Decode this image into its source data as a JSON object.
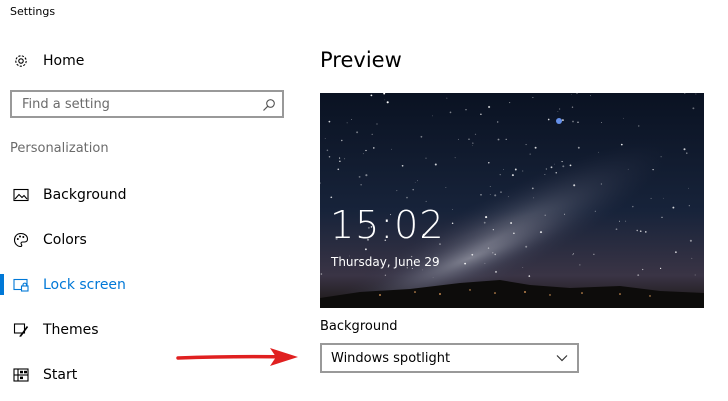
{
  "window": {
    "title": "Settings"
  },
  "sidebar": {
    "home": {
      "label": "Home",
      "icon": "gear-icon"
    },
    "search": {
      "placeholder": "Find a setting",
      "value": "",
      "icon": "search-icon"
    },
    "section_header": "Personalization",
    "items": [
      {
        "label": "Background",
        "icon": "picture-icon",
        "active": false
      },
      {
        "label": "Colors",
        "icon": "palette-icon",
        "active": false
      },
      {
        "label": "Lock screen",
        "icon": "lock-screen-icon",
        "active": true
      },
      {
        "label": "Themes",
        "icon": "brush-icon",
        "active": false
      },
      {
        "label": "Start",
        "icon": "start-tiles-icon",
        "active": false
      }
    ]
  },
  "main": {
    "preview_title": "Preview",
    "lock_preview": {
      "time": "15:02",
      "date": "Thursday, June 29"
    },
    "background_label": "Background",
    "background_dropdown": {
      "selected": "Windows spotlight"
    }
  },
  "colors": {
    "accent": "#0078d7",
    "annotation_arrow": "#e02020",
    "border": "#999999"
  }
}
